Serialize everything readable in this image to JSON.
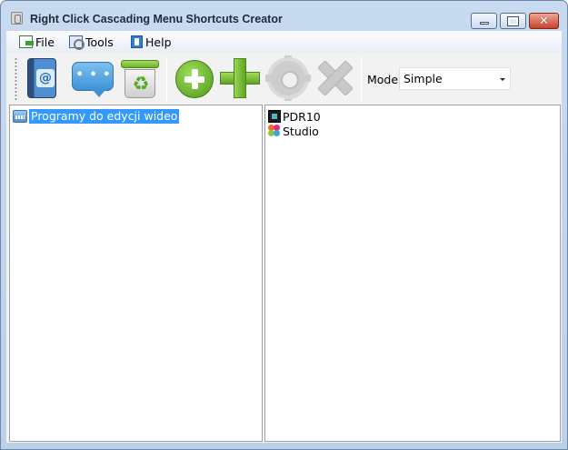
{
  "window": {
    "title": "Right Click Cascading Menu Shortcuts Creator",
    "controls": {
      "minimize": "minimize",
      "maximize": "maximize",
      "close": "✕"
    }
  },
  "menu": {
    "file": "File",
    "tools": "Tools",
    "help": "Help"
  },
  "toolbar": {
    "buttons": [
      {
        "name": "address-book",
        "icon": "address-book-icon"
      },
      {
        "name": "speech-bubble",
        "icon": "chat-bubble-icon"
      },
      {
        "name": "recycle-bin",
        "icon": "recycle-bin-icon"
      },
      {
        "name": "add-circle",
        "icon": "plus-circle-icon"
      },
      {
        "name": "add",
        "icon": "plus-icon"
      },
      {
        "name": "settings",
        "icon": "gear-icon",
        "state": "disabled"
      },
      {
        "name": "delete",
        "icon": "x-icon",
        "state": "disabled"
      }
    ],
    "mode_label": "Mode",
    "mode_value": "Simple"
  },
  "tree": {
    "items": [
      {
        "label": "Programy do edycji wideo",
        "selected": true,
        "icon": "folder-menu-icon"
      }
    ]
  },
  "list": {
    "items": [
      {
        "label": "PDR10",
        "icon": "film-icon"
      },
      {
        "label": "Studio",
        "icon": "flower-icon"
      }
    ]
  },
  "colors": {
    "selection": "#3399ff",
    "accent_green": "#6db22c",
    "close_red": "#c8412a"
  }
}
